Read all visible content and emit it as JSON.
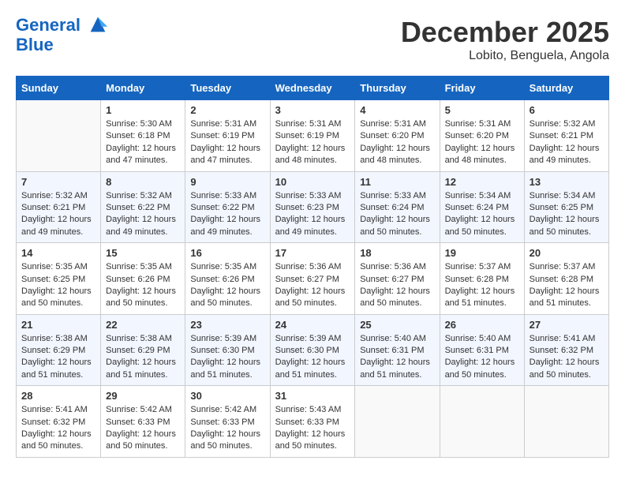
{
  "header": {
    "logo_line1": "General",
    "logo_line2": "Blue",
    "month": "December 2025",
    "location": "Lobito, Benguela, Angola"
  },
  "days_header": [
    "Sunday",
    "Monday",
    "Tuesday",
    "Wednesday",
    "Thursday",
    "Friday",
    "Saturday"
  ],
  "weeks": [
    [
      {
        "num": "",
        "info": ""
      },
      {
        "num": "1",
        "info": "Sunrise: 5:30 AM\nSunset: 6:18 PM\nDaylight: 12 hours\nand 47 minutes."
      },
      {
        "num": "2",
        "info": "Sunrise: 5:31 AM\nSunset: 6:19 PM\nDaylight: 12 hours\nand 47 minutes."
      },
      {
        "num": "3",
        "info": "Sunrise: 5:31 AM\nSunset: 6:19 PM\nDaylight: 12 hours\nand 48 minutes."
      },
      {
        "num": "4",
        "info": "Sunrise: 5:31 AM\nSunset: 6:20 PM\nDaylight: 12 hours\nand 48 minutes."
      },
      {
        "num": "5",
        "info": "Sunrise: 5:31 AM\nSunset: 6:20 PM\nDaylight: 12 hours\nand 48 minutes."
      },
      {
        "num": "6",
        "info": "Sunrise: 5:32 AM\nSunset: 6:21 PM\nDaylight: 12 hours\nand 49 minutes."
      }
    ],
    [
      {
        "num": "7",
        "info": "Sunrise: 5:32 AM\nSunset: 6:21 PM\nDaylight: 12 hours\nand 49 minutes."
      },
      {
        "num": "8",
        "info": "Sunrise: 5:32 AM\nSunset: 6:22 PM\nDaylight: 12 hours\nand 49 minutes."
      },
      {
        "num": "9",
        "info": "Sunrise: 5:33 AM\nSunset: 6:22 PM\nDaylight: 12 hours\nand 49 minutes."
      },
      {
        "num": "10",
        "info": "Sunrise: 5:33 AM\nSunset: 6:23 PM\nDaylight: 12 hours\nand 49 minutes."
      },
      {
        "num": "11",
        "info": "Sunrise: 5:33 AM\nSunset: 6:24 PM\nDaylight: 12 hours\nand 50 minutes."
      },
      {
        "num": "12",
        "info": "Sunrise: 5:34 AM\nSunset: 6:24 PM\nDaylight: 12 hours\nand 50 minutes."
      },
      {
        "num": "13",
        "info": "Sunrise: 5:34 AM\nSunset: 6:25 PM\nDaylight: 12 hours\nand 50 minutes."
      }
    ],
    [
      {
        "num": "14",
        "info": "Sunrise: 5:35 AM\nSunset: 6:25 PM\nDaylight: 12 hours\nand 50 minutes."
      },
      {
        "num": "15",
        "info": "Sunrise: 5:35 AM\nSunset: 6:26 PM\nDaylight: 12 hours\nand 50 minutes."
      },
      {
        "num": "16",
        "info": "Sunrise: 5:35 AM\nSunset: 6:26 PM\nDaylight: 12 hours\nand 50 minutes."
      },
      {
        "num": "17",
        "info": "Sunrise: 5:36 AM\nSunset: 6:27 PM\nDaylight: 12 hours\nand 50 minutes."
      },
      {
        "num": "18",
        "info": "Sunrise: 5:36 AM\nSunset: 6:27 PM\nDaylight: 12 hours\nand 50 minutes."
      },
      {
        "num": "19",
        "info": "Sunrise: 5:37 AM\nSunset: 6:28 PM\nDaylight: 12 hours\nand 51 minutes."
      },
      {
        "num": "20",
        "info": "Sunrise: 5:37 AM\nSunset: 6:28 PM\nDaylight: 12 hours\nand 51 minutes."
      }
    ],
    [
      {
        "num": "21",
        "info": "Sunrise: 5:38 AM\nSunset: 6:29 PM\nDaylight: 12 hours\nand 51 minutes."
      },
      {
        "num": "22",
        "info": "Sunrise: 5:38 AM\nSunset: 6:29 PM\nDaylight: 12 hours\nand 51 minutes."
      },
      {
        "num": "23",
        "info": "Sunrise: 5:39 AM\nSunset: 6:30 PM\nDaylight: 12 hours\nand 51 minutes."
      },
      {
        "num": "24",
        "info": "Sunrise: 5:39 AM\nSunset: 6:30 PM\nDaylight: 12 hours\nand 51 minutes."
      },
      {
        "num": "25",
        "info": "Sunrise: 5:40 AM\nSunset: 6:31 PM\nDaylight: 12 hours\nand 51 minutes."
      },
      {
        "num": "26",
        "info": "Sunrise: 5:40 AM\nSunset: 6:31 PM\nDaylight: 12 hours\nand 50 minutes."
      },
      {
        "num": "27",
        "info": "Sunrise: 5:41 AM\nSunset: 6:32 PM\nDaylight: 12 hours\nand 50 minutes."
      }
    ],
    [
      {
        "num": "28",
        "info": "Sunrise: 5:41 AM\nSunset: 6:32 PM\nDaylight: 12 hours\nand 50 minutes."
      },
      {
        "num": "29",
        "info": "Sunrise: 5:42 AM\nSunset: 6:33 PM\nDaylight: 12 hours\nand 50 minutes."
      },
      {
        "num": "30",
        "info": "Sunrise: 5:42 AM\nSunset: 6:33 PM\nDaylight: 12 hours\nand 50 minutes."
      },
      {
        "num": "31",
        "info": "Sunrise: 5:43 AM\nSunset: 6:33 PM\nDaylight: 12 hours\nand 50 minutes."
      },
      {
        "num": "",
        "info": ""
      },
      {
        "num": "",
        "info": ""
      },
      {
        "num": "",
        "info": ""
      }
    ]
  ]
}
